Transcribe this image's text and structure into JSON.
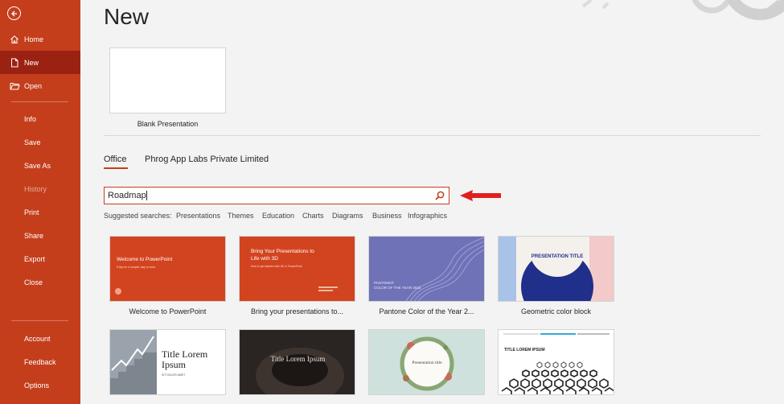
{
  "sidebar": {
    "back_icon": "back-arrow-icon",
    "items": [
      {
        "label": "Home",
        "icon": "home-icon"
      },
      {
        "label": "New",
        "icon": "new-file-icon"
      },
      {
        "label": "Open",
        "icon": "open-folder-icon"
      },
      {
        "label": "Info"
      },
      {
        "label": "Save"
      },
      {
        "label": "Save As"
      },
      {
        "label": "History"
      },
      {
        "label": "Print"
      },
      {
        "label": "Share"
      },
      {
        "label": "Export"
      },
      {
        "label": "Close"
      },
      {
        "label": "Account"
      },
      {
        "label": "Feedback"
      },
      {
        "label": "Options"
      }
    ],
    "active": "New",
    "disabled": [
      "History"
    ]
  },
  "main": {
    "title": "New",
    "blank": {
      "label": "Blank Presentation"
    },
    "tabs": [
      {
        "label": "Office",
        "selected": true
      },
      {
        "label": "Phrog App Labs Private Limited",
        "selected": false
      }
    ],
    "search": {
      "value": "Roadmap",
      "icon": "search-icon"
    },
    "suggested": {
      "label": "Suggested searches:",
      "items": [
        "Presentations",
        "Themes",
        "Education",
        "Charts",
        "Diagrams",
        "Business",
        "Infographics"
      ]
    },
    "templates": [
      {
        "label": "Welcome to PowerPoint",
        "thumb_title": "Welcome to PowerPoint",
        "thumb_sub": "5 tips for a simpler way to work"
      },
      {
        "label": "Bring your presentations to...",
        "thumb_title": "Bring Your Presentations to Life with 3D",
        "thumb_sub": "How to get started with 3D in PowerPoint"
      },
      {
        "label": "Pantone Color of the Year 2...",
        "thumb_title": "PANTONE®",
        "thumb_sub": "COLOR OF THE YEAR 2022"
      },
      {
        "label": "Geometric color block",
        "thumb_title": "PRESENTATION TITLE",
        "thumb_sub": ""
      },
      {
        "label": "",
        "thumb_title": "Title Lorem Ipsum",
        "thumb_sub": "SIT DOLOR AMET"
      },
      {
        "label": "",
        "thumb_title": "Title Lorem Ipsum",
        "thumb_sub": ""
      },
      {
        "label": "",
        "thumb_title": "Presentation title",
        "thumb_sub": ""
      },
      {
        "label": "",
        "thumb_title": "TITLE LOREM IPSUM",
        "thumb_sub": ""
      }
    ]
  },
  "colors": {
    "accent": "#c43e1c",
    "active": "#9b2213",
    "arrow": "#e0201f"
  }
}
